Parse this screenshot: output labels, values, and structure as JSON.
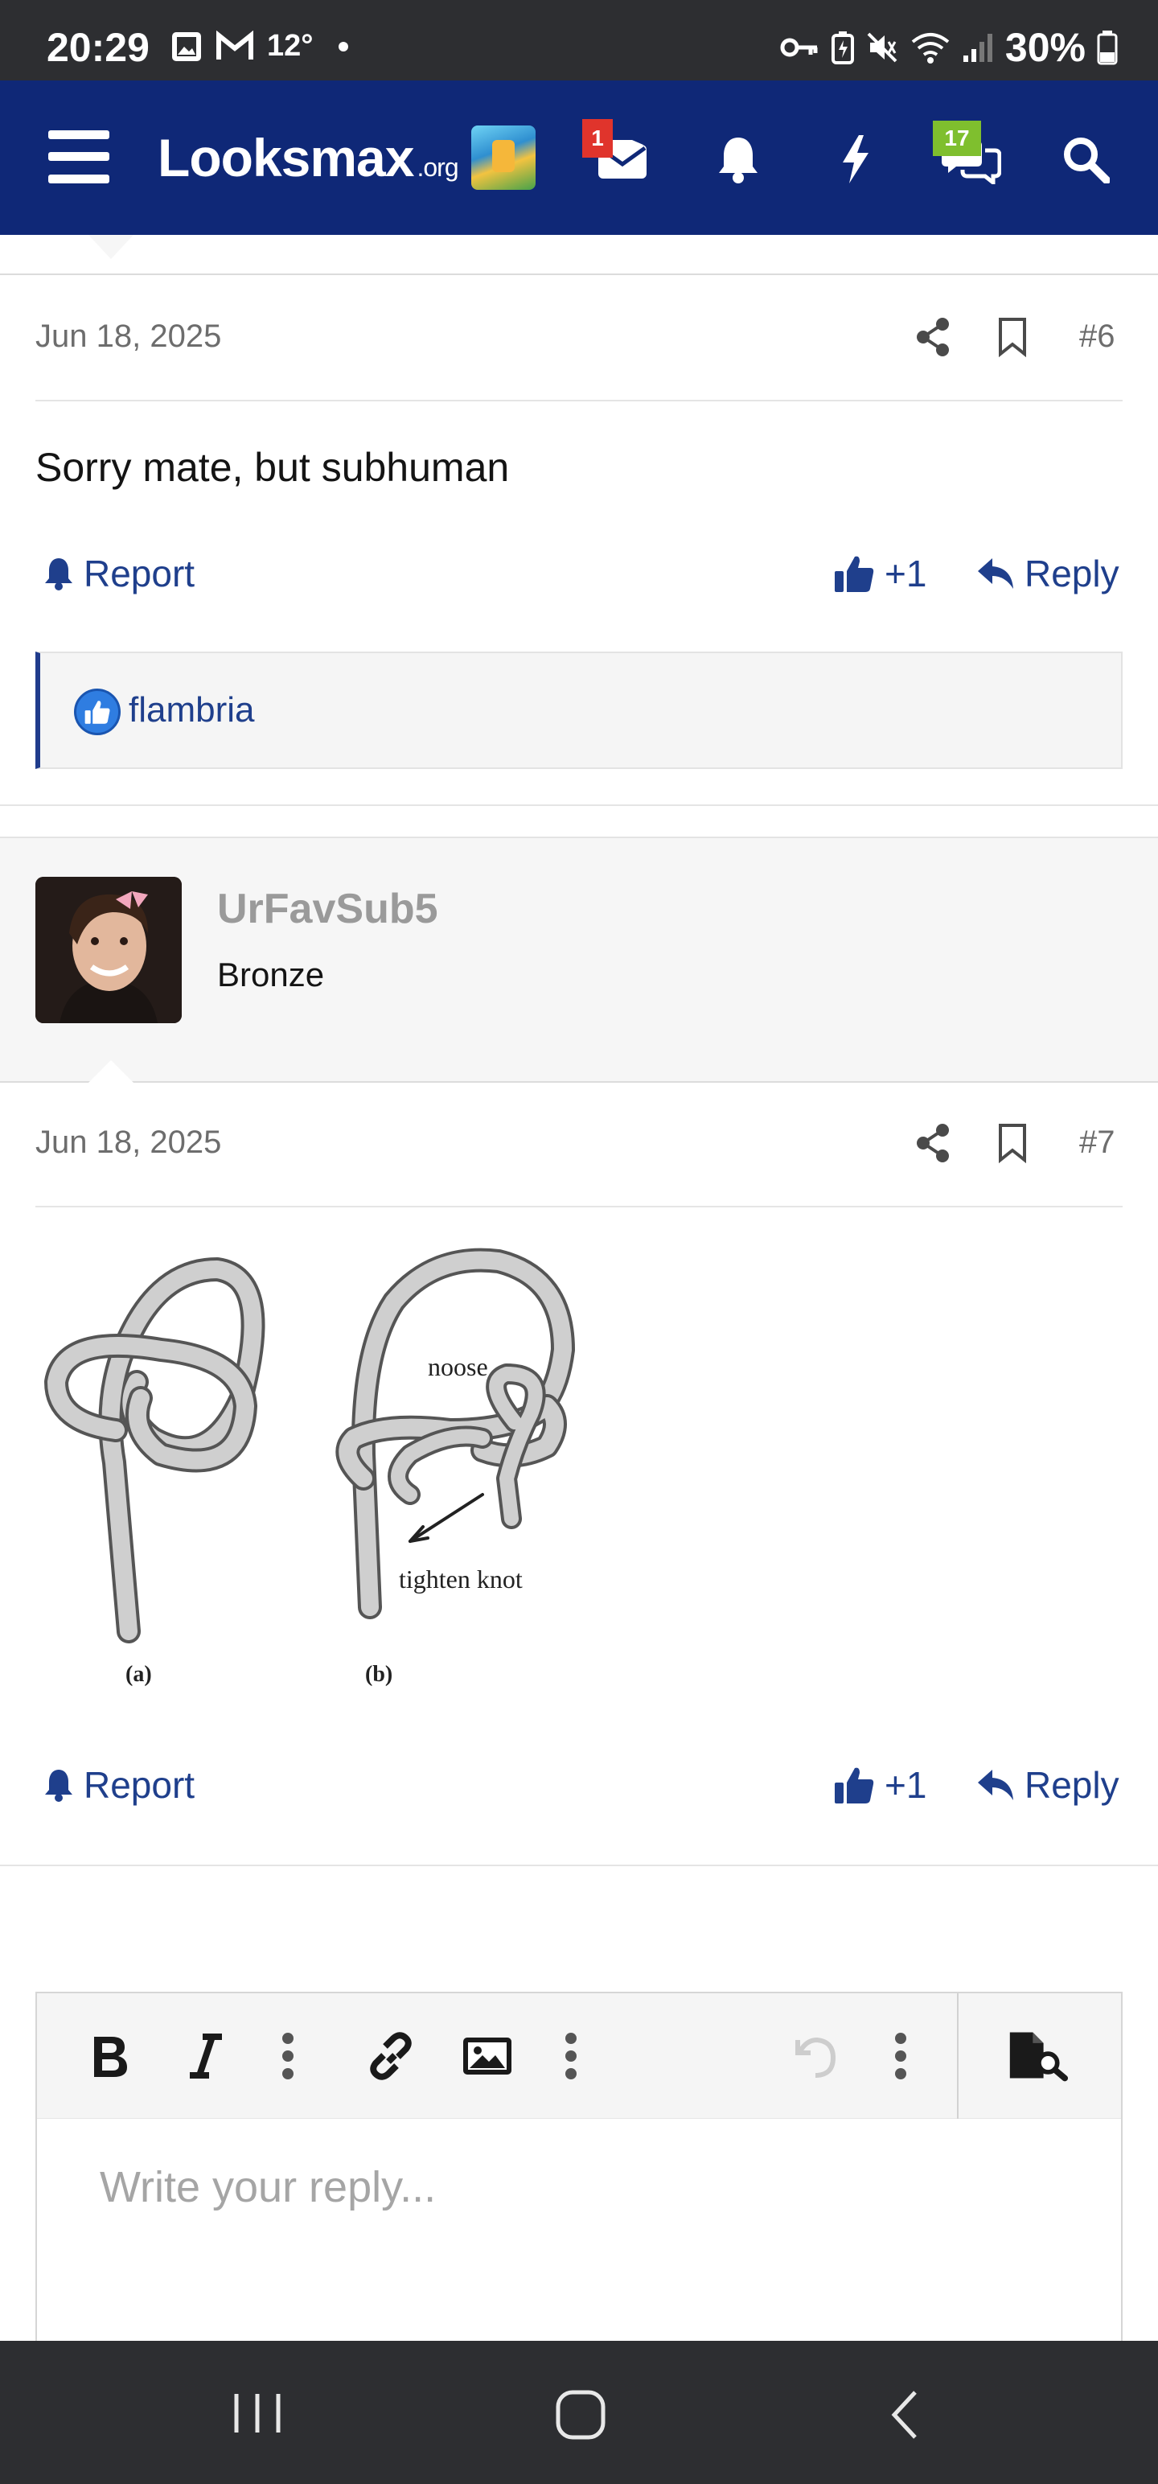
{
  "status_bar": {
    "time": "20:29",
    "temperature": "12°",
    "battery": "30%"
  },
  "header": {
    "logo_main": "Looksmax",
    "logo_suffix": ".org",
    "inbox_badge": "1",
    "chat_badge": "17",
    "colors": {
      "background": "#0f2877",
      "badge_red": "#e0342c",
      "badge_green": "#7fbf2e"
    }
  },
  "post6": {
    "date": "Jun 18, 2025",
    "number": "#6",
    "body": "Sorry mate, but subhuman",
    "report_label": "Report",
    "like_count": "+1",
    "reply_label": "Reply",
    "reactor": "flambria"
  },
  "post7": {
    "username": "UrFavSub5",
    "user_title": "Bronze",
    "date": "Jun 18, 2025",
    "number": "#7",
    "image": {
      "label_noose": "noose",
      "label_tighten": "tighten knot",
      "caption_a": "(a)",
      "caption_b": "(b)"
    },
    "report_label": "Report",
    "like_count": "+1",
    "reply_label": "Reply"
  },
  "editor": {
    "placeholder": "Write your reply..."
  },
  "icons": [
    "menu-icon",
    "envelope-icon",
    "bell-icon",
    "bolt-icon",
    "chat-icon",
    "search-icon",
    "share-icon",
    "bookmark-icon",
    "thumbs-up-icon",
    "reply-icon",
    "bold-icon",
    "italic-icon",
    "link-icon",
    "image-icon",
    "undo-icon",
    "preview-icon"
  ]
}
